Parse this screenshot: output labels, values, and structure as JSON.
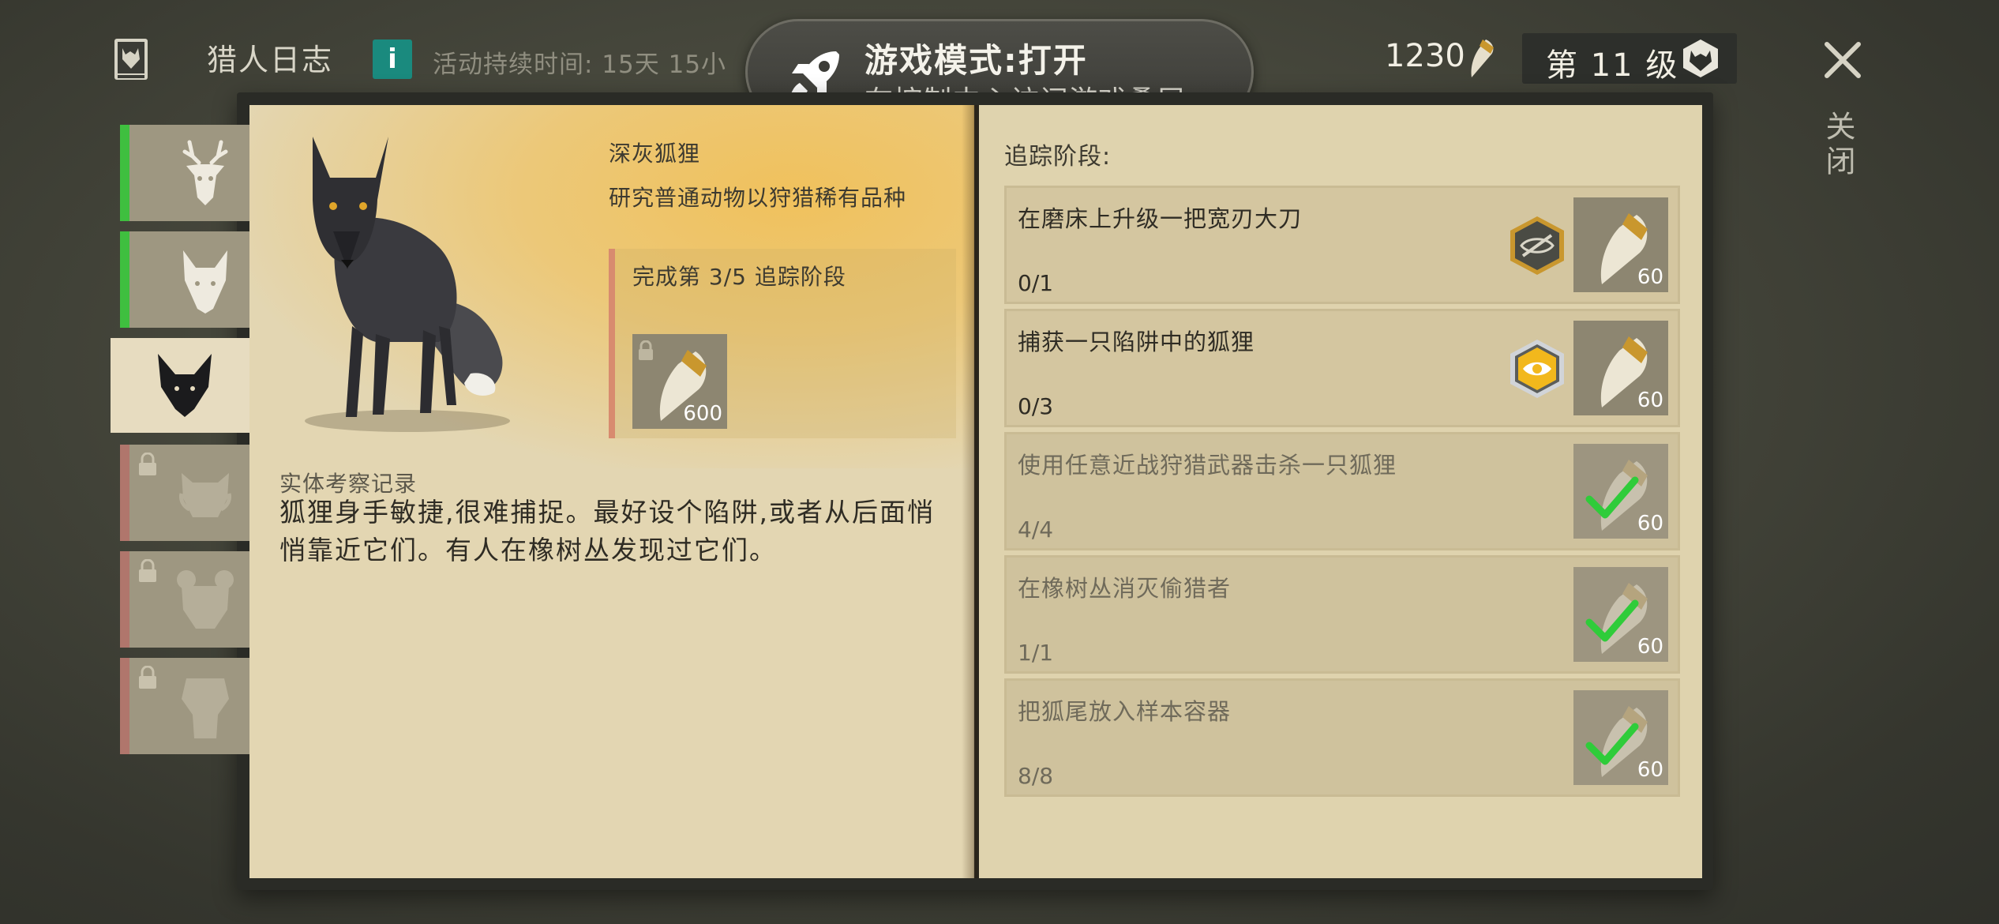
{
  "header": {
    "journal_title": "猎人日志",
    "info_label": "i",
    "event_duration": "活动持续时间:  15天 15小",
    "game_mode": {
      "title": "游戏模式:打开",
      "subtitle": "在控制中心访问游戏叠层"
    },
    "currency_amount": "1230",
    "level_label": "第 11 级",
    "close_label": "关闭"
  },
  "tabs": [
    {
      "animal": "deer",
      "status": "complete",
      "locked": false
    },
    {
      "animal": "wolf",
      "status": "complete",
      "locked": false
    },
    {
      "animal": "fox",
      "status": "selected",
      "locked": false
    },
    {
      "animal": "boar",
      "status": "locked",
      "locked": true
    },
    {
      "animal": "bear",
      "status": "locked",
      "locked": true
    },
    {
      "animal": "crocodile",
      "status": "locked",
      "locked": true
    }
  ],
  "animal": {
    "name": "深灰狐狸",
    "description": "研究普通动物以狩猎稀有品种",
    "stage_progress": "完成第 3/5 追踪阶段",
    "stage_reward_amount": "600",
    "field_notes_label": "实体考察记录",
    "field_notes": "狐狸身手敏捷,很难捕捉。最好设个陷阱,或者从后面悄悄靠近它们。有人在橡树丛发现过它们。"
  },
  "tracking": {
    "header": "追踪阶段:",
    "tasks": [
      {
        "title": "在磨床上升级一把宽刃大刀",
        "count": "0/1",
        "reward": "60",
        "done": false,
        "hint": "hidden"
      },
      {
        "title": "捕获一只陷阱中的狐狸",
        "count": "0/3",
        "reward": "60",
        "done": false,
        "hint": "visible"
      },
      {
        "title": "使用任意近战狩猎武器击杀一只狐狸",
        "count": "4/4",
        "reward": "60",
        "done": true
      },
      {
        "title": "在橡树丛消灭偷猎者",
        "count": "1/1",
        "reward": "60",
        "done": true
      },
      {
        "title": "把狐尾放入样本容器",
        "count": "8/8",
        "reward": "60",
        "done": true
      }
    ]
  },
  "colors": {
    "complete_tab": "#3fbf3f",
    "locked_tab": "#b0766c",
    "info_button": "#1a8a7e",
    "check": "#2fcc3a"
  }
}
